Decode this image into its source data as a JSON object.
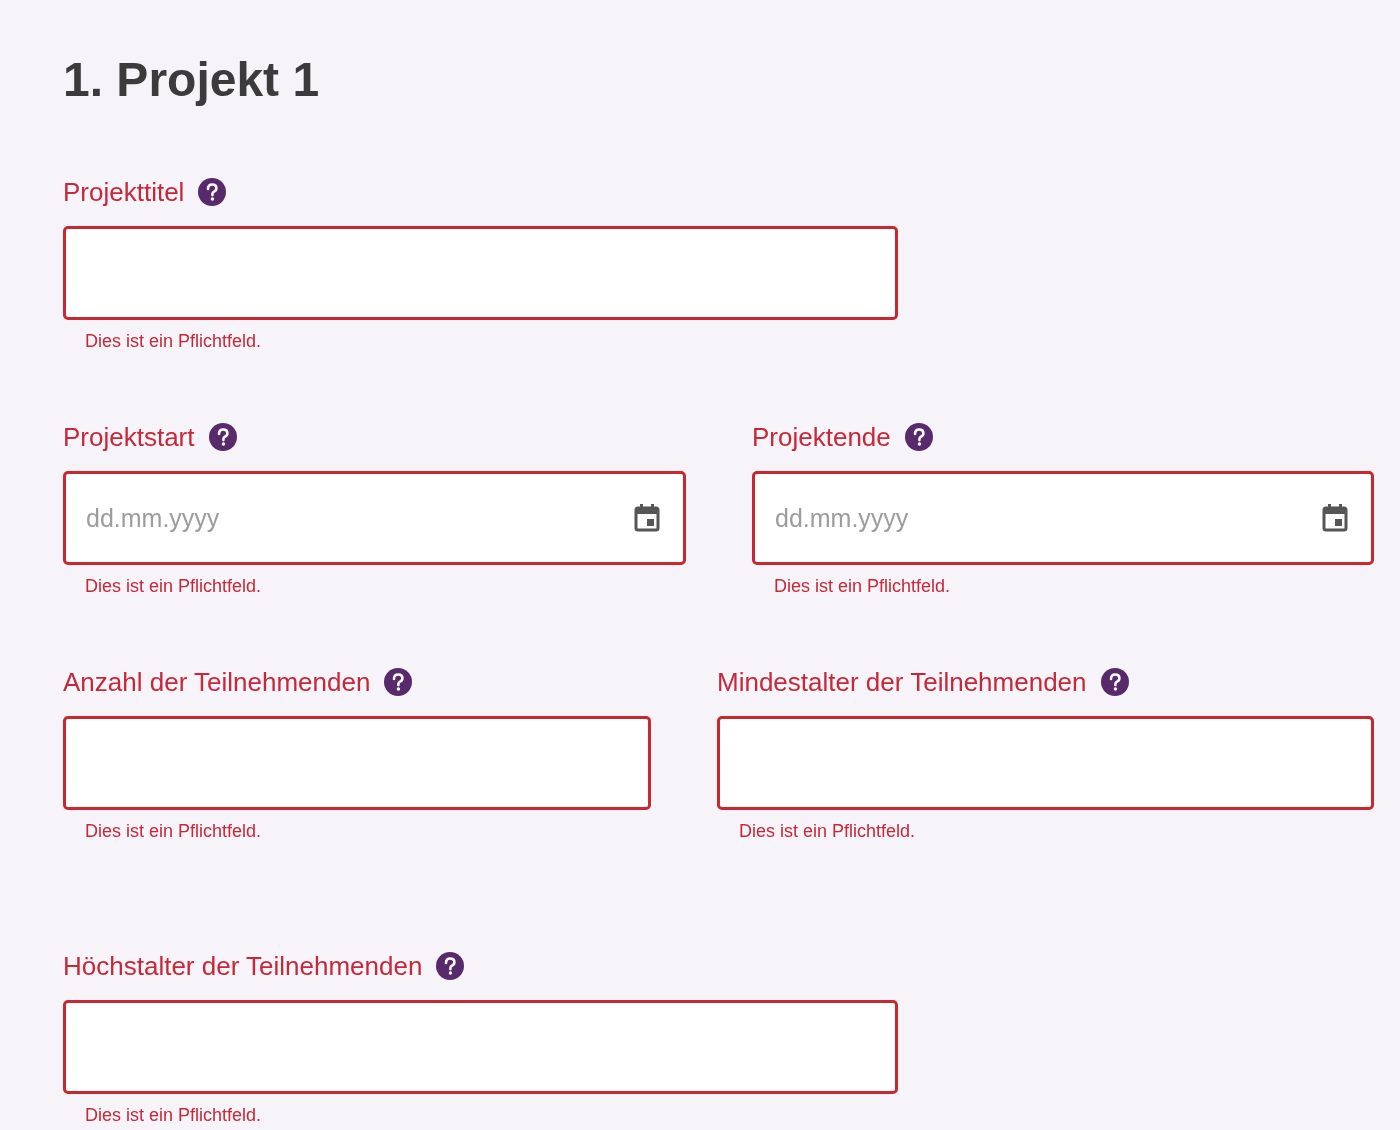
{
  "heading": "1. Projekt 1",
  "rows": [
    {
      "fields": [
        {
          "label": "Projekttitel",
          "kind": "text",
          "invalid": true,
          "error": "Dies ist ein Pflichtfeld."
        }
      ]
    },
    {
      "fields": [
        {
          "label": "Projektstart",
          "kind": "date",
          "placeholder": "dd.mm.yyyy",
          "invalid": true,
          "error": "Dies ist ein Pflichtfeld."
        },
        {
          "label": "Projektende",
          "kind": "date",
          "placeholder": "dd.mm.yyyy",
          "invalid": true,
          "error": "Dies ist ein Pflichtfeld."
        }
      ]
    },
    {
      "fields": [
        {
          "label": "Anzahl der Teilnehmenden",
          "kind": "text",
          "invalid": true,
          "error": "Dies ist ein Pflichtfeld."
        },
        {
          "label": "Mindestalter der Teilnehmenden",
          "kind": "text",
          "invalid": true,
          "error": "Dies ist ein Pflichtfeld."
        }
      ]
    },
    {
      "fields": [
        {
          "label": "Höchstalter der Teilnehmenden",
          "kind": "text",
          "invalid": true,
          "error": "Dies ist ein Pflichtfeld."
        }
      ]
    }
  ]
}
